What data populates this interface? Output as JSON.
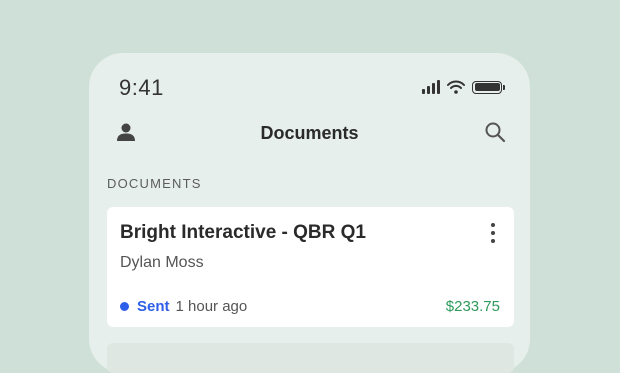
{
  "status_bar": {
    "time": "9:41"
  },
  "nav": {
    "title": "Documents",
    "user_icon": "user-icon",
    "search_icon": "search-icon"
  },
  "section": {
    "label": "DOCUMENTS"
  },
  "documents": [
    {
      "title": "Bright Interactive - QBR Q1",
      "client": "Dylan Moss",
      "status": "Sent",
      "status_color": "#2e5fe8",
      "time_ago": "1 hour ago",
      "amount": "$233.75",
      "amount_color": "#2e9a5a"
    }
  ]
}
